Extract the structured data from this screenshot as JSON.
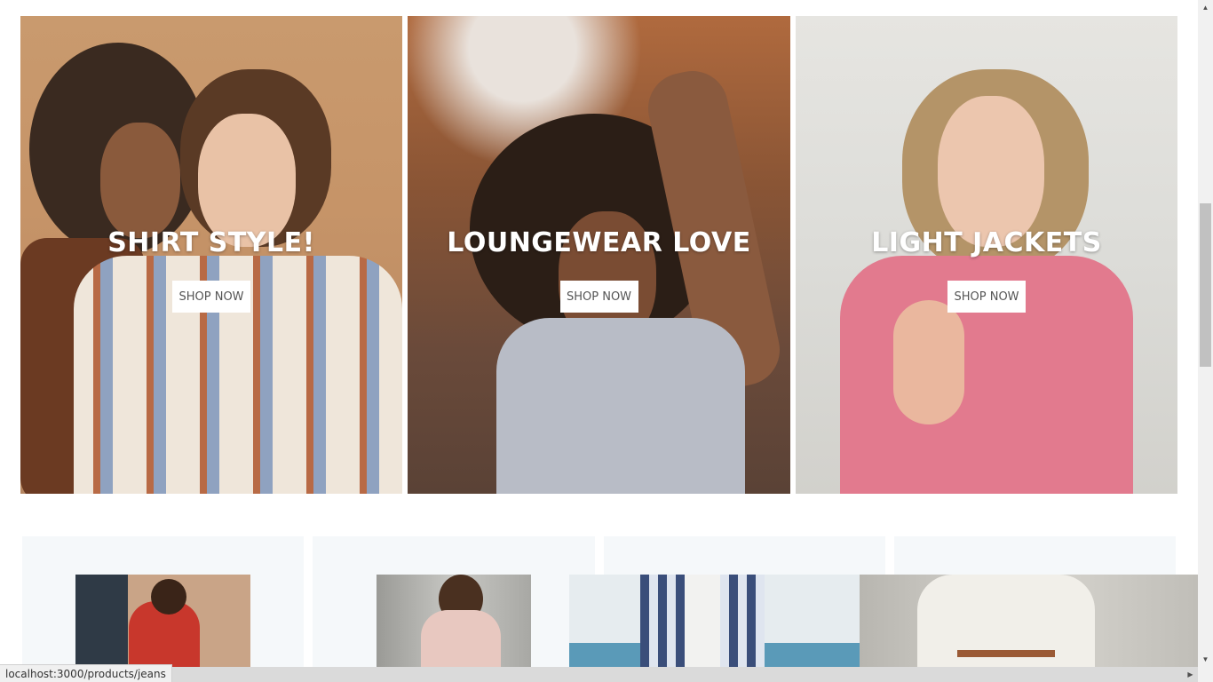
{
  "categories": [
    {
      "title": "SHIRT STYLE!",
      "button": "SHOP NOW"
    },
    {
      "title": "LOUNGEWEAR LOVE",
      "button": "SHOP NOW"
    },
    {
      "title": "LIGHT JACKETS",
      "button": "SHOP NOW"
    }
  ],
  "products": [
    {
      "image": "woman-red-coat-photo"
    },
    {
      "image": "woman-pink-cardigan-photo"
    },
    {
      "image": "woman-plaid-coat-photo"
    },
    {
      "image": "woman-white-blazer-photo"
    }
  ],
  "status_bar": {
    "url": "localhost:3000/products/jeans"
  },
  "scrollbar": {
    "up_icon": "arrow-up-icon",
    "down_icon": "arrow-down-icon",
    "right_icon": "arrow-right-icon"
  }
}
